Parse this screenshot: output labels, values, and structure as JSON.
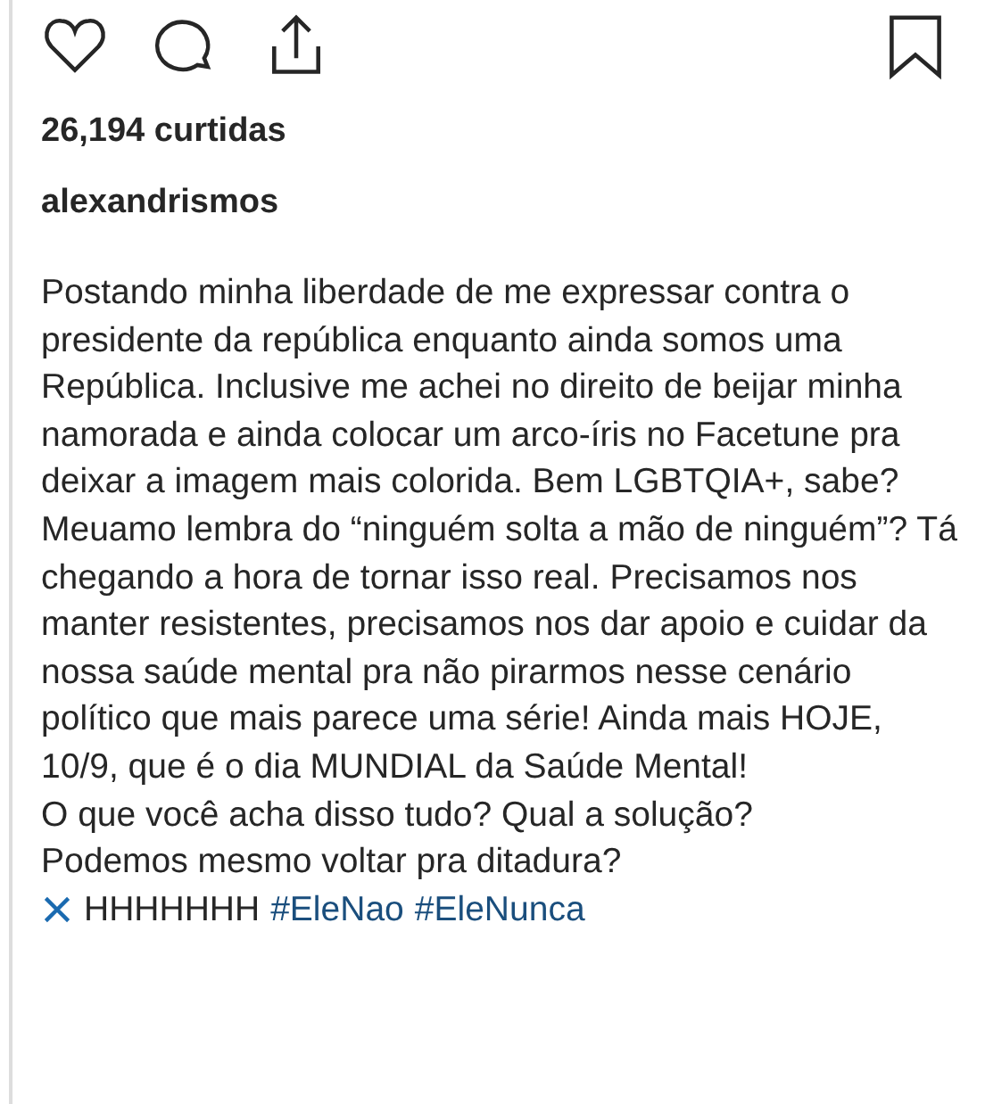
{
  "likes": "26,194 curtidas",
  "username": "alexandrismos",
  "caption": [
    "Postando minha liberdade de me expressar contra o presidente da república enquanto ainda somos uma República. Inclusive me achei no direito de beijar minha namorada e ainda colocar um arco-íris no Facetune pra deixar a imagem mais colorida. Bem LGBTQIA+, sabe?",
    "Meuamo lembra do “ninguém solta a mão de ninguém”? Tá chegando a hora de tornar isso real. Precisamos nos manter resistentes, precisamos nos dar apoio e cuidar da nossa saúde mental pra não pirarmos nesse cenário político que mais parece uma série! Ainda mais HOJE, 10/9, que é o dia MUNDIAL da Saúde Mental!",
    "O que você acha disso tudo? Qual a solução?",
    "Podemos mesmo voltar pra ditadura?"
  ],
  "last_line": {
    "text": "HHHHHHH",
    "hashtags": [
      "#EleNao",
      "#EleNunca"
    ]
  }
}
